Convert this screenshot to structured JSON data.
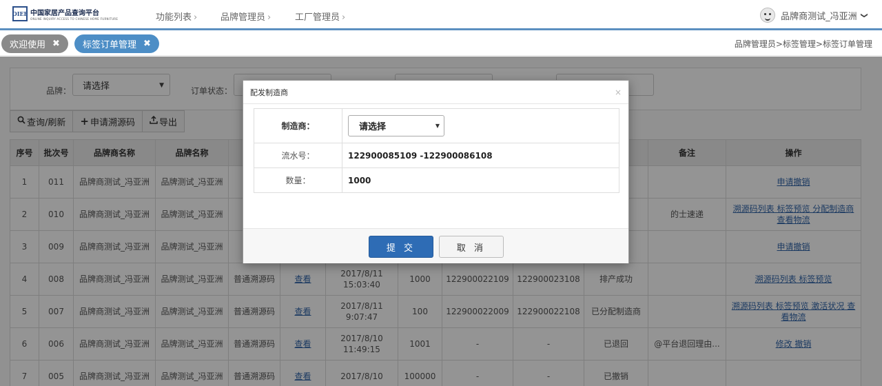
{
  "topbar": {
    "logo_mark": "OIEF",
    "logo_cn": "中国家居产品查询平台",
    "logo_en": "ONLINE INQUIRY ACCESS TO CHINESE HOME FURNITURE",
    "nav": [
      "功能列表",
      "品牌管理员",
      "工厂管理员"
    ],
    "nav_arrow": "›",
    "user": "品牌商测试_冯亚洲",
    "user_chevron": "❯"
  },
  "tabs": {
    "welcome": "欢迎使用",
    "active": "标签订单管理",
    "close": "✖",
    "breadcrumb": "品牌管理员>标签管理>标签订单管理"
  },
  "filters": {
    "brand_label": "品牌：",
    "brand_value": "请选择",
    "status_label": "订单状态："
  },
  "toolbar": {
    "query": "查询/刷新",
    "apply": "申请溯源码",
    "export": "导出"
  },
  "table": {
    "headers": [
      "序号",
      "批次号",
      "品牌商名称",
      "品牌名称",
      "溯",
      "",
      "",
      "",
      "",
      "",
      "",
      "备注",
      "操作"
    ],
    "rows": [
      {
        "no": "1",
        "batch": "011",
        "vendor": "品牌商测试_冯亚洲",
        "brand": "品牌测试_冯亚洲",
        "type": "普",
        "view": "",
        "time": "",
        "qty": "",
        "start": "",
        "end": "",
        "status": "厂",
        "note": "",
        "ops": "申请撤销"
      },
      {
        "no": "2",
        "batch": "010",
        "vendor": "品牌商测试_冯亚洲",
        "brand": "品牌测试_冯亚洲",
        "type": "普",
        "view": "",
        "time": "",
        "qty": "",
        "start": "",
        "end": "",
        "status": "",
        "note": "的士速递",
        "ops": "溯源码列表 标签预览 分配制造商 查看物流"
      },
      {
        "no": "3",
        "batch": "009",
        "vendor": "品牌商测试_冯亚洲",
        "brand": "品牌测试_冯亚洲",
        "type": "普",
        "view": "",
        "time": "",
        "qty": "",
        "start": "",
        "end": "",
        "status": "功",
        "note": "",
        "ops": "申请撤销"
      },
      {
        "no": "4",
        "batch": "008",
        "vendor": "品牌商测试_冯亚洲",
        "brand": "品牌测试_冯亚洲",
        "type": "普通溯源码",
        "view": "查看",
        "time": "2017/8/11 15:03:40",
        "qty": "1000",
        "start": "122900022109",
        "end": "122900023108",
        "status": "排产成功",
        "note": "",
        "ops": "溯源码列表 标签预览"
      },
      {
        "no": "5",
        "batch": "007",
        "vendor": "品牌商测试_冯亚洲",
        "brand": "品牌测试_冯亚洲",
        "type": "普通溯源码",
        "view": "查看",
        "time": "2017/8/11 9:07:47",
        "qty": "100",
        "start": "122900022009",
        "end": "122900022108",
        "status": "已分配制造商",
        "note": "",
        "ops": "溯源码列表 标签预览 激活状况 查看物流"
      },
      {
        "no": "6",
        "batch": "006",
        "vendor": "品牌商测试_冯亚洲",
        "brand": "品牌测试_冯亚洲",
        "type": "普通溯源码",
        "view": "查看",
        "time": "2017/8/10 11:49:15",
        "qty": "1001",
        "start": "-",
        "end": "-",
        "status": "已退回",
        "note": "@平台退回理由...",
        "ops": "修改 撤销"
      },
      {
        "no": "7",
        "batch": "005",
        "vendor": "品牌商测试_冯亚洲",
        "brand": "品牌测试_冯亚洲",
        "type": "普通溯源码",
        "view": "查看",
        "time": "2017/8/10",
        "qty": "100000",
        "start": "-",
        "end": "-",
        "status": "已撤销",
        "note": "",
        "ops": ""
      }
    ]
  },
  "modal": {
    "title": "配发制造商",
    "close": "×",
    "manufacturer_label": "制造商：",
    "manufacturer_value": "请选择",
    "serial_label": "流水号：",
    "serial_value": "122900085109 -122900086108",
    "qty_label": "数量：",
    "qty_value": "1000",
    "submit": "提 交",
    "cancel": "取 消"
  }
}
